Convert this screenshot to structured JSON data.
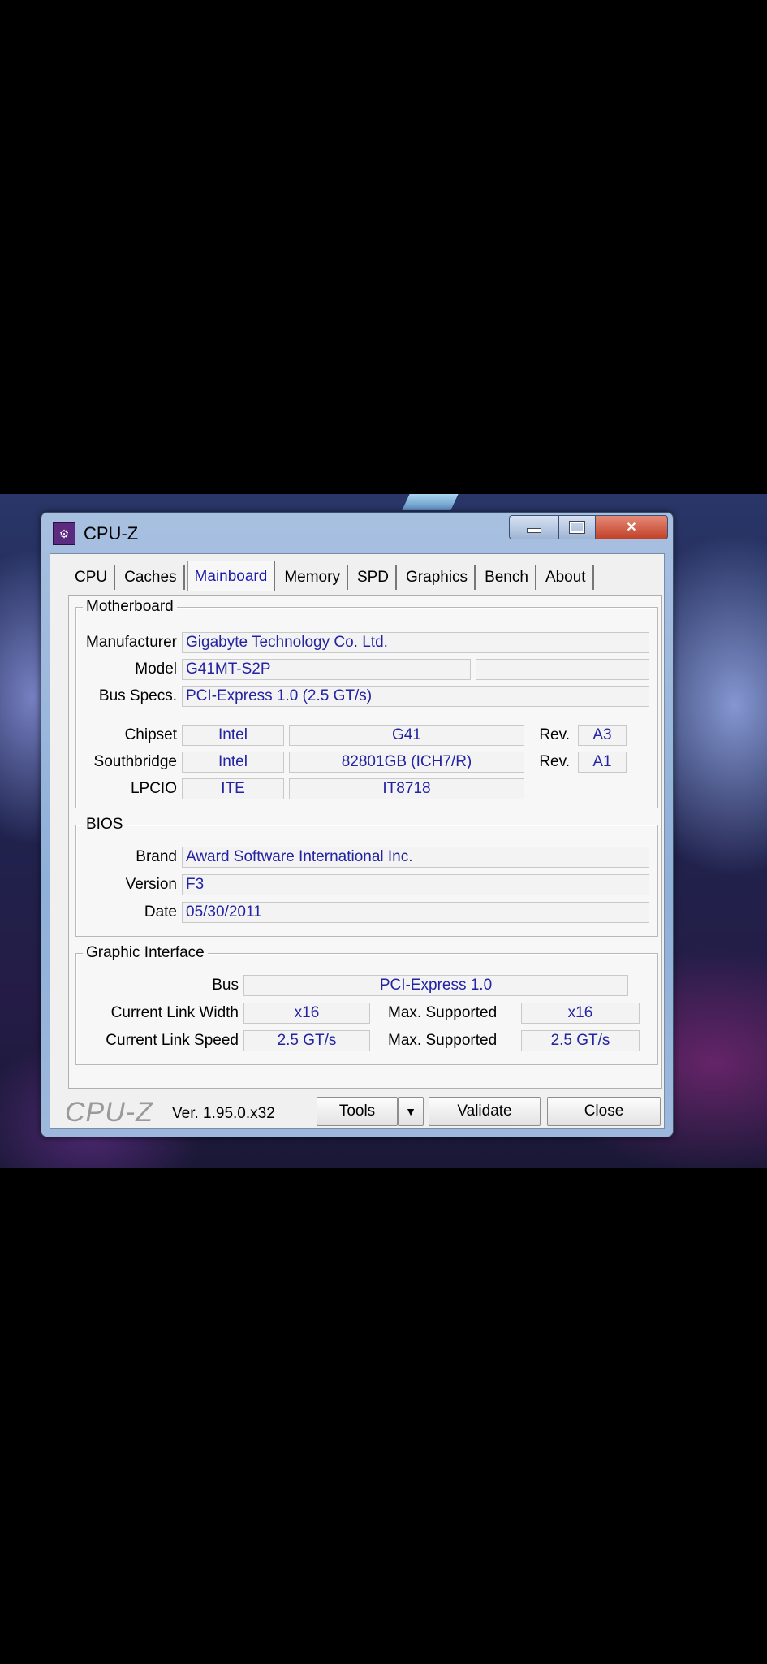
{
  "window": {
    "title": "CPU-Z",
    "icon": "cpu-z-app-icon",
    "controls": {
      "minimize": "minimize-icon",
      "maximize": "maximize-icon",
      "close": "close-icon",
      "close_glyph": "✕"
    }
  },
  "tabs": [
    {
      "label": "CPU"
    },
    {
      "label": "Caches"
    },
    {
      "label": "Mainboard",
      "active": true
    },
    {
      "label": "Memory"
    },
    {
      "label": "SPD"
    },
    {
      "label": "Graphics"
    },
    {
      "label": "Bench"
    },
    {
      "label": "About"
    }
  ],
  "motherboard": {
    "group_label": "Motherboard",
    "manufacturer_label": "Manufacturer",
    "manufacturer": "Gigabyte Technology Co. Ltd.",
    "model_label": "Model",
    "model": "G41MT-S2P",
    "model_extra": "",
    "bus_specs_label": "Bus Specs.",
    "bus_specs": "PCI-Express 1.0 (2.5 GT/s)",
    "chipset_label": "Chipset",
    "chipset_vendor": "Intel",
    "chipset_model": "G41",
    "chipset_rev_label": "Rev.",
    "chipset_rev": "A3",
    "southbridge_label": "Southbridge",
    "southbridge_vendor": "Intel",
    "southbridge_model": "82801GB (ICH7/R)",
    "southbridge_rev_label": "Rev.",
    "southbridge_rev": "A1",
    "lpcio_label": "LPCIO",
    "lpcio_vendor": "ITE",
    "lpcio_model": "IT8718"
  },
  "bios": {
    "group_label": "BIOS",
    "brand_label": "Brand",
    "brand": "Award Software International Inc.",
    "version_label": "Version",
    "version": "F3",
    "date_label": "Date",
    "date": "05/30/2011"
  },
  "graphic_interface": {
    "group_label": "Graphic Interface",
    "bus_label": "Bus",
    "bus": "PCI-Express 1.0",
    "link_width_label": "Current Link Width",
    "link_width": "x16",
    "max_width_label": "Max. Supported",
    "max_width": "x16",
    "link_speed_label": "Current Link Speed",
    "link_speed": "2.5 GT/s",
    "max_speed_label": "Max. Supported",
    "max_speed": "2.5 GT/s"
  },
  "footer": {
    "brand": "CPU-Z",
    "version": "Ver. 1.95.0.x32",
    "tools_label": "Tools",
    "tools_arrow": "▼",
    "validate_label": "Validate",
    "close_label": "Close"
  }
}
